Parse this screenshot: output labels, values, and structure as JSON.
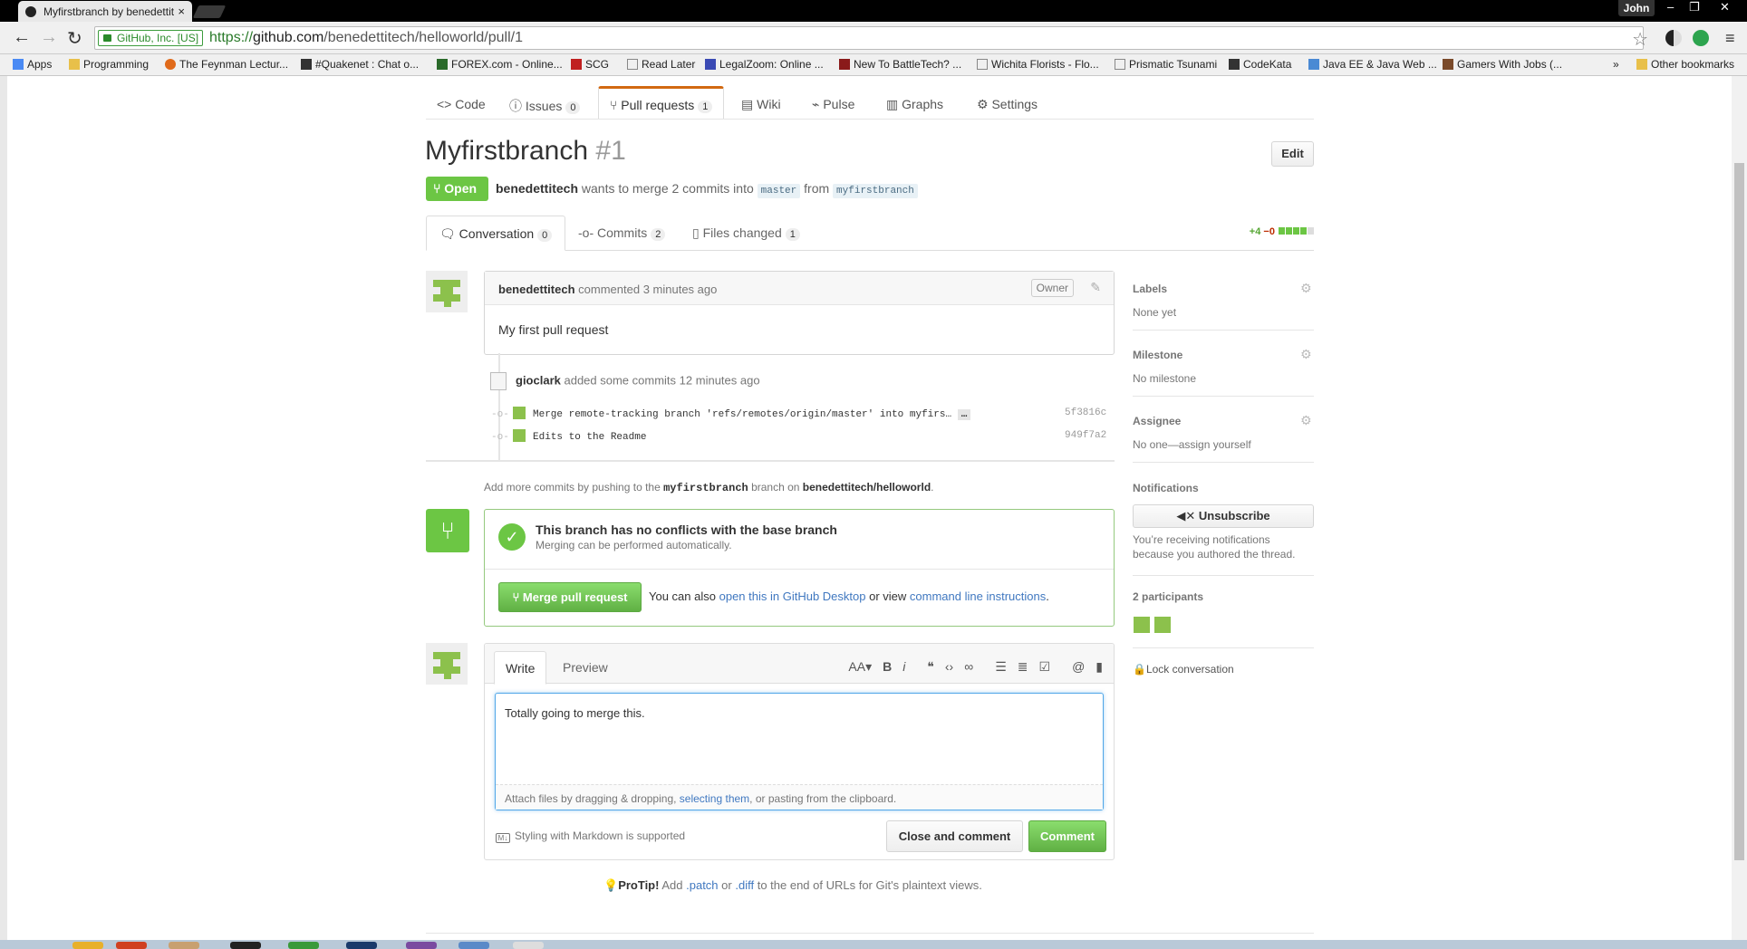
{
  "browser": {
    "tab_title": "Myfirstbranch by benedettit",
    "profile": "John",
    "secure_label": "GitHub, Inc. [US]",
    "url_prefix": "https://",
    "url_host": "github.com",
    "url_path": "/benedettitech/helloworld/pull/1",
    "bookmarks": [
      "Apps",
      "Programming",
      "The Feynman Lectur...",
      "#Quakenet : Chat o...",
      "FOREX.com - Online...",
      "SCG",
      "Read Later",
      "LegalZoom: Online ...",
      "New To BattleTech? ...",
      "Wichita Florists - Flo...",
      "Prismatic Tsunami",
      "CodeKata",
      "Java EE & Java Web ...",
      "Gamers With Jobs (...",
      "Other bookmarks"
    ]
  },
  "repo_nav": [
    {
      "label": "Code",
      "icon": "code-icon"
    },
    {
      "label": "Issues",
      "count": "0",
      "icon": "issue-icon"
    },
    {
      "label": "Pull requests",
      "count": "1",
      "icon": "pull-request-icon"
    },
    {
      "label": "Wiki",
      "icon": "book-icon"
    },
    {
      "label": "Pulse",
      "icon": "pulse-icon"
    },
    {
      "label": "Graphs",
      "icon": "graph-icon"
    },
    {
      "label": "Settings",
      "icon": "gear-icon"
    }
  ],
  "pr": {
    "title": "Myfirstbranch",
    "number": "#1",
    "edit_label": "Edit",
    "state": "Open",
    "author": "benedettitech",
    "merge_text": "wants to merge 2 commits into",
    "base": "master",
    "from_text": "from",
    "head": "myfirstbranch"
  },
  "tabs": [
    {
      "label": "Conversation",
      "count": "0"
    },
    {
      "label": "Commits",
      "count": "2"
    },
    {
      "label": "Files changed",
      "count": "1"
    }
  ],
  "diffstat": {
    "add": "+4",
    "del": "−0"
  },
  "comment": {
    "author": "benedettitech",
    "action": "commented",
    "time": "3 minutes ago",
    "badge": "Owner",
    "body": "My first pull request"
  },
  "commits_event": {
    "author": "gioclark",
    "text": "added some commits",
    "time": "12 minutes ago",
    "commits": [
      {
        "msg": "Merge remote-tracking branch 'refs/remotes/origin/master' into myfirs…",
        "sha": "5f3816c"
      },
      {
        "msg": "Edits to the Readme",
        "sha": "949f7a2"
      }
    ]
  },
  "push_msg": {
    "pre": "Add more commits by pushing to the",
    "branch": "myfirstbranch",
    "mid": "branch on",
    "repo": "benedettitech/helloworld",
    "end": "."
  },
  "merge": {
    "title": "This branch has no conflicts with the base branch",
    "subtitle": "Merging can be performed automatically.",
    "button": "Merge pull request",
    "also": "You can also",
    "desktop_link": "open this in GitHub Desktop",
    "or_view": "or view",
    "cli_link": "command line instructions",
    "period": "."
  },
  "new_comment": {
    "write_tab": "Write",
    "preview_tab": "Preview",
    "value": "Totally going to merge this.",
    "attach_pre": "Attach files by dragging & dropping,",
    "attach_link": "selecting them",
    "attach_post": ", or pasting from the clipboard.",
    "markdown_note": "Styling with Markdown is supported",
    "close_button": "Close and comment",
    "comment_button": "Comment"
  },
  "protip": {
    "label": "ProTip!",
    "pre": "Add",
    "patch": ".patch",
    "or": "or",
    "diff": ".diff",
    "post": "to the end of URLs for Git's plaintext views."
  },
  "sidebar": {
    "labels_h": "Labels",
    "labels_v": "None yet",
    "milestone_h": "Milestone",
    "milestone_v": "No milestone",
    "assignee_h": "Assignee",
    "assignee_v": "No one—assign yourself",
    "notif_h": "Notifications",
    "unsubscribe": "Unsubscribe",
    "notif_note1": "You’re receiving notifications",
    "notif_note2": "because you authored the thread.",
    "participants": "2 participants",
    "lock": "Lock conversation"
  },
  "colors": {
    "accent": "#6cc644",
    "link": "#4078c0",
    "tab_accent": "#d26911"
  }
}
